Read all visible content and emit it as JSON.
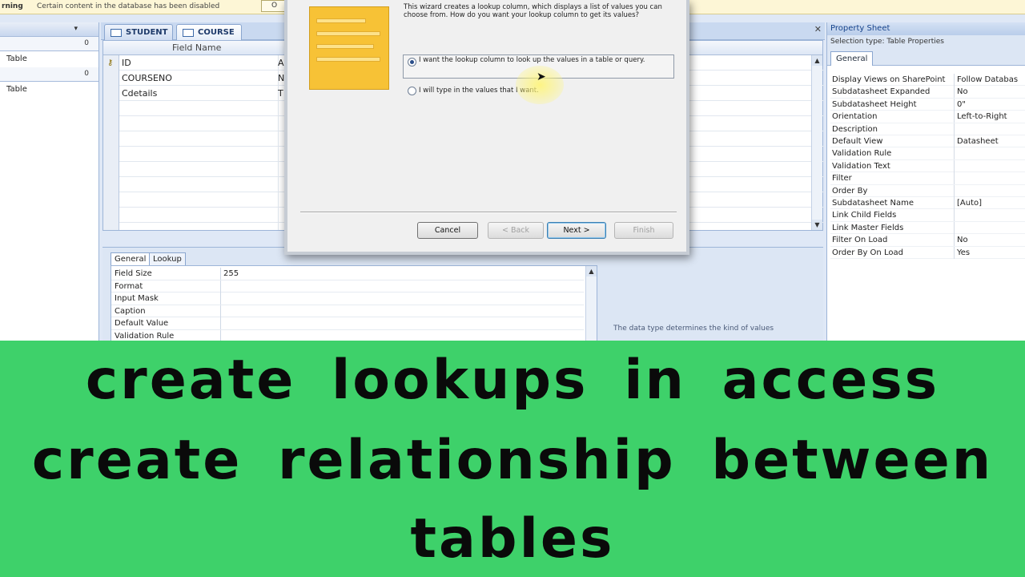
{
  "message_bar": {
    "warning_label": "rning",
    "message": "Certain content in the database has been disabled",
    "options_button": "O"
  },
  "nav_pane": {
    "header1_count": "0",
    "item1": "Table",
    "header2_count": "0",
    "item2": "Table"
  },
  "tabs": [
    {
      "label": "STUDENT"
    },
    {
      "label": "COURSE"
    }
  ],
  "design_grid": {
    "header_field_name": "Field Name",
    "rows": [
      {
        "name": "ID",
        "type": "A"
      },
      {
        "name": "COURSENO",
        "type": "N"
      },
      {
        "name": "Cdetails",
        "type": "T"
      }
    ]
  },
  "field_properties": {
    "tabs": [
      "General",
      "Lookup"
    ],
    "rows": [
      {
        "label": "Field Size",
        "value": "255"
      },
      {
        "label": "Format",
        "value": ""
      },
      {
        "label": "Input Mask",
        "value": ""
      },
      {
        "label": "Caption",
        "value": ""
      },
      {
        "label": "Default Value",
        "value": ""
      },
      {
        "label": "Validation Rule",
        "value": ""
      }
    ],
    "hint": "The data type determines the kind of values"
  },
  "property_sheet": {
    "title": "Property Sheet",
    "selection": "Selection type:  Table Properties",
    "tab": "General",
    "rows": [
      {
        "label": "Display Views on SharePoint",
        "value": "Follow Databas"
      },
      {
        "label": "Subdatasheet Expanded",
        "value": "No"
      },
      {
        "label": "Subdatasheet Height",
        "value": "0\""
      },
      {
        "label": "Orientation",
        "value": "Left-to-Right"
      },
      {
        "label": "Description",
        "value": ""
      },
      {
        "label": "Default View",
        "value": "Datasheet"
      },
      {
        "label": "Validation Rule",
        "value": ""
      },
      {
        "label": "Validation Text",
        "value": ""
      },
      {
        "label": "Filter",
        "value": ""
      },
      {
        "label": "Order By",
        "value": ""
      },
      {
        "label": "Subdatasheet Name",
        "value": "[Auto]"
      },
      {
        "label": "Link Child Fields",
        "value": ""
      },
      {
        "label": "Link Master Fields",
        "value": ""
      },
      {
        "label": "Filter On Load",
        "value": "No"
      },
      {
        "label": "Order By On Load",
        "value": "Yes"
      }
    ]
  },
  "wizard": {
    "intro": "This wizard creates a lookup column, which displays a list of values you can choose from. How do you want your lookup column to get its values?",
    "option1": "I want the lookup column to look up the values in a table or query.",
    "option2": "I will type in the values that I want.",
    "selected_option": 1,
    "buttons": {
      "cancel": "Cancel",
      "back": "< Back",
      "next": "Next >",
      "finish": "Finish"
    }
  },
  "banner": {
    "line1": "create lookups in access",
    "line2": "create relationship between",
    "line3": "tables",
    "background": "#3ed16a"
  }
}
